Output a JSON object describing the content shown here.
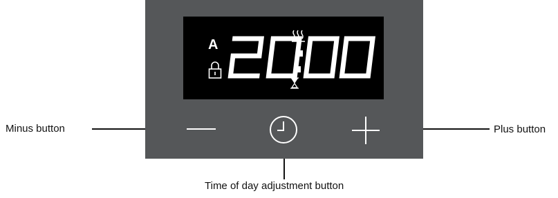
{
  "display": {
    "mode_letter": "A",
    "time": "20:00",
    "icons": [
      "lock-icon",
      "hourglass-icon",
      "heat-icon"
    ]
  },
  "buttons": [
    {
      "name": "minus-button",
      "icon": "minus-icon"
    },
    {
      "name": "clock-button",
      "icon": "clock-icon"
    },
    {
      "name": "plus-button",
      "icon": "plus-icon"
    }
  ],
  "labels": {
    "minus": "Minus button",
    "clock": "Time of day adjustment button",
    "plus": "Plus button"
  },
  "colors": {
    "panel": "#555759",
    "display_bg": "#000000",
    "segments": "#ffffff",
    "callout": "#111111"
  }
}
